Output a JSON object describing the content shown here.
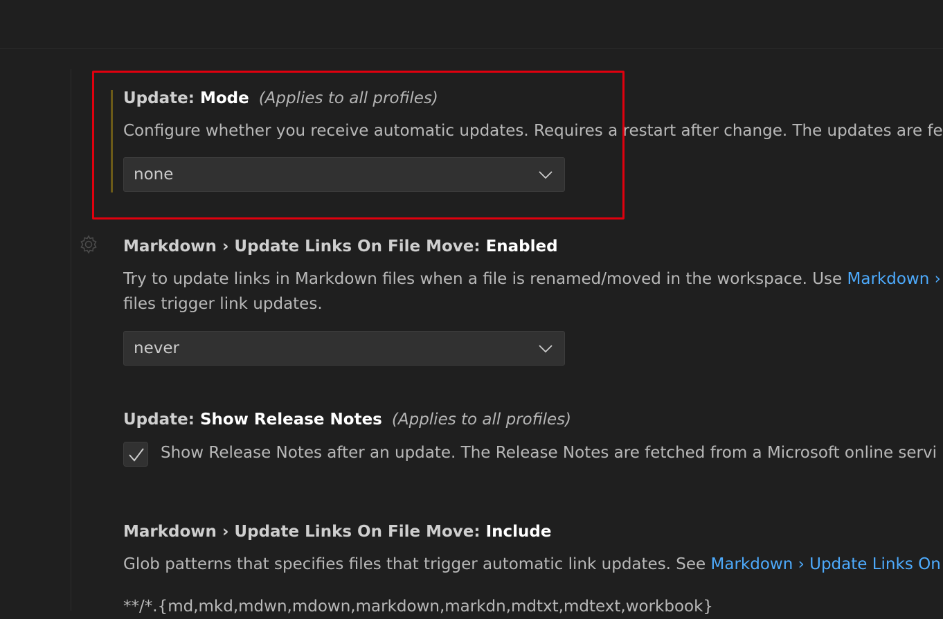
{
  "settings": {
    "update_mode": {
      "category": "Update: ",
      "name": "Mode",
      "scope": "(Applies to all profiles)",
      "description": "Configure whether you receive automatic updates. Requires a restart after change. The updates are fe",
      "value": "none"
    },
    "md_update_links": {
      "category": "Markdown › Update Links On File Move: ",
      "name": "Enabled",
      "description_prefix": "Try to update links in Markdown files when a file is renamed/moved in the workspace. Use ",
      "description_link": "Markdown ›",
      "description_line2": "files trigger link updates.",
      "value": "never"
    },
    "release_notes": {
      "category": "Update: ",
      "name": "Show Release Notes",
      "scope": "(Applies to all profiles)",
      "checkbox_label": "Show Release Notes after an update. The Release Notes are fetched from a Microsoft online servi",
      "checked": true
    },
    "md_include": {
      "category": "Markdown › Update Links On File Move: ",
      "name": "Include",
      "description_prefix": "Glob patterns that specifies files that trigger automatic link updates. See ",
      "description_link": "Markdown › Update Links On",
      "pattern": " **/*.{md,mkd,mdwn,mdown,markdown,markdn,mdtxt,mdtext,workbook}"
    }
  },
  "icons": {
    "dropdown": "chevron-down-icon",
    "gear": "gear-icon",
    "check": "check-icon"
  },
  "colors": {
    "background": "#1f1f1f",
    "link": "#4daafc",
    "highlight_border": "#e0000e",
    "modified_indicator": "#6b5a18"
  }
}
